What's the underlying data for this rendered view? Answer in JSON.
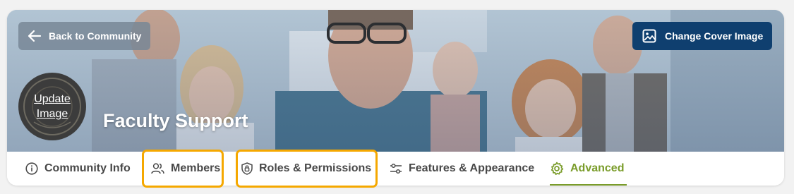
{
  "header": {
    "back_label": "Back to Community",
    "change_cover_label": "Change Cover Image",
    "update_image_line1": "Update",
    "update_image_line2": "Image",
    "community_name": "Faculty Support"
  },
  "tabs": [
    {
      "label": "Community Info",
      "icon": "info-circle-icon",
      "active": false,
      "highlighted": false
    },
    {
      "label": "Members",
      "icon": "users-icon",
      "active": false,
      "highlighted": true
    },
    {
      "label": "Roles & Permissions",
      "icon": "shield-lock-icon",
      "active": false,
      "highlighted": true
    },
    {
      "label": "Features & Appearance",
      "icon": "sliders-icon",
      "active": false,
      "highlighted": false
    },
    {
      "label": "Advanced",
      "icon": "gear-icon",
      "active": true,
      "highlighted": false
    }
  ],
  "colors": {
    "accent_green": "#7a9c2a",
    "cover_button_bg": "#0f3f6f",
    "highlight_orange": "#f5a800",
    "tab_text": "#484848"
  }
}
